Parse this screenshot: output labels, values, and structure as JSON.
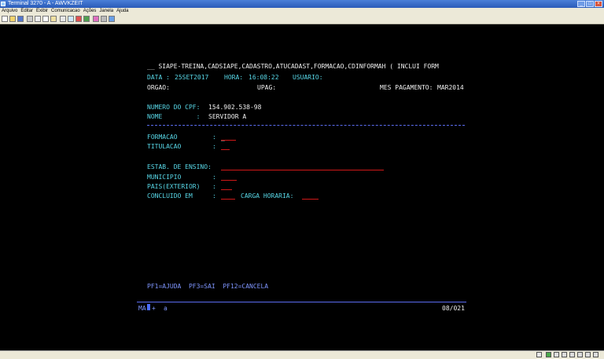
{
  "window": {
    "title": "Terminal 3270 - A - AWVKZEIT"
  },
  "menu": {
    "items": [
      "Arquivo",
      "Editar",
      "Exibir",
      "Comunicacao",
      "Ações",
      "Janela",
      "Ajuda"
    ]
  },
  "toolbar": {
    "icons": [
      "new-icon",
      "open-icon",
      "save-icon",
      "print-icon",
      "cut-icon",
      "copy-icon",
      "paste-icon",
      "undo-icon",
      "find-icon",
      "settings-icon",
      "macro-icon",
      "color-icon",
      "keyboard-icon",
      "help-icon"
    ]
  },
  "screen": {
    "header_line": "__ SIAPE-TREINA,CADSIAPE,CADASTRO,ATUCADAST,FORMACAO,CDINFORMAH ( INCLUI FORM",
    "data_label": "DATA : ",
    "data_value": "25SET2017",
    "hora_label": "HORA: ",
    "hora_value": "16:08:22",
    "usuario_label": "USUARIO:",
    "orgao_label": "ORGAO:",
    "upag_label": "UPAG:",
    "mes_label": "MES PAGAMENTO:",
    "mes_value": "MAR2014",
    "cpf_label": "NUMERO DO CPF:",
    "cpf_value": "154.902.538-98",
    "nome_label": "NOME         :",
    "nome_value": "SERVIDOR A",
    "formacao_label": "FORMACAO",
    "titulacao_label": "TITULACAO",
    "estab_label": "ESTAB. DE ENSINO:",
    "municipio_label": "MUNICIPIO",
    "pais_label": "PAIS(EXTERIOR)",
    "concluido_label": "CONCLUIDO EM",
    "carga_label": "CARGA HORARIA:",
    "colon": ":",
    "cursor_char": "_",
    "pf_keys": "PF1=AJUDA  PF3=SAI  PF12=CANCELA",
    "oia_left": "MA",
    "oia_plus": "+",
    "oia_a": "a",
    "oia_pos": "08/021"
  },
  "colors": {
    "label": "#58d8e8",
    "field": "#7f96ff",
    "text": "#f0f0f0",
    "underline": "#d01818",
    "background": "#000000"
  }
}
